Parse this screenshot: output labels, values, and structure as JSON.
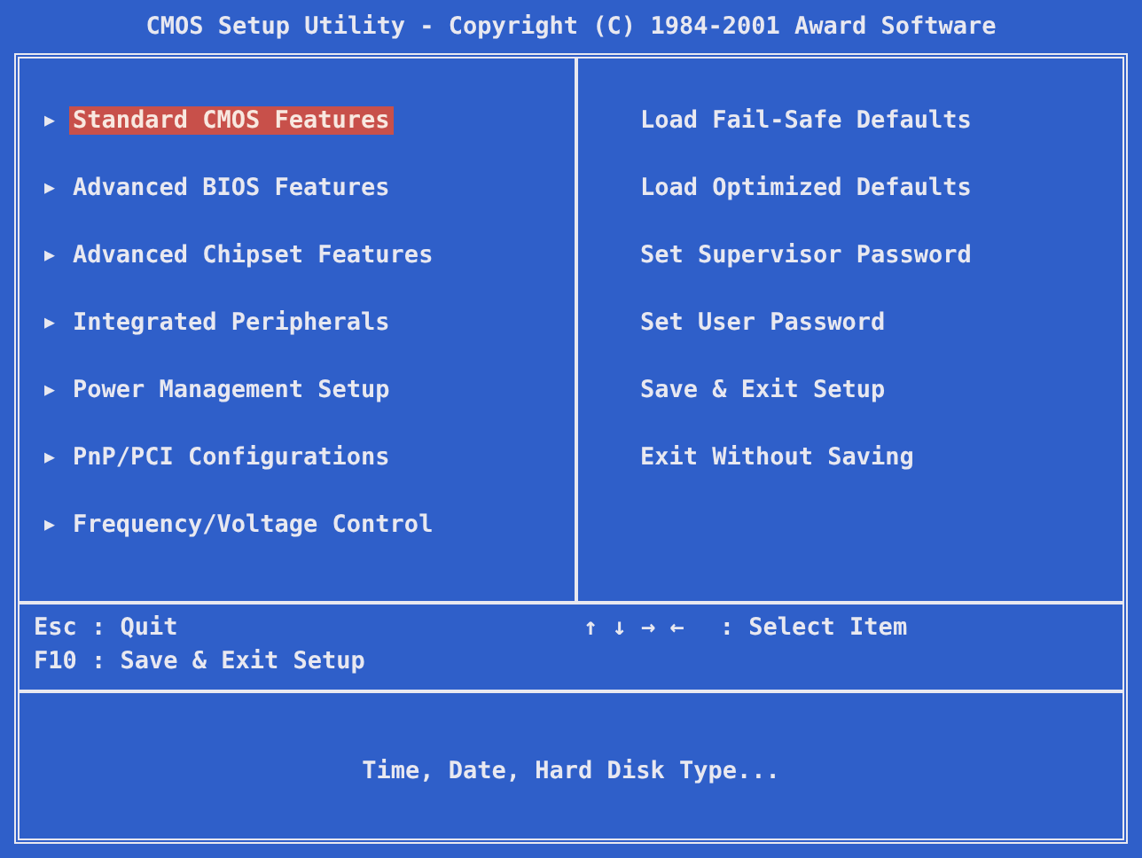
{
  "title": "CMOS Setup Utility - Copyright (C) 1984-2001 Award Software",
  "left_menu": [
    {
      "marker": "▶",
      "label": "Standard CMOS Features",
      "selected": true
    },
    {
      "marker": "▶",
      "label": "Advanced BIOS Features",
      "selected": false
    },
    {
      "marker": "▶",
      "label": "Advanced Chipset Features",
      "selected": false
    },
    {
      "marker": "▶",
      "label": "Integrated Peripherals",
      "selected": false
    },
    {
      "marker": "▶",
      "label": "Power Management Setup",
      "selected": false
    },
    {
      "marker": "▶",
      "label": "PnP/PCI Configurations",
      "selected": false
    },
    {
      "marker": "▶",
      "label": "Frequency/Voltage Control",
      "selected": false
    }
  ],
  "right_menu": [
    {
      "label": "Load Fail-Safe Defaults",
      "selected": false
    },
    {
      "label": "Load Optimized Defaults",
      "selected": false
    },
    {
      "label": "Set Supervisor Password",
      "selected": false
    },
    {
      "label": "Set User Password",
      "selected": false
    },
    {
      "label": "Save & Exit Setup",
      "selected": false
    },
    {
      "label": "Exit Without Saving",
      "selected": false
    }
  ],
  "key_help": {
    "left": [
      "Esc : Quit",
      "F10 : Save & Exit Setup"
    ],
    "arrows": "↑ ↓ → ←",
    "arrows_action": ": Select Item"
  },
  "description": "Time, Date, Hard Disk Type..."
}
